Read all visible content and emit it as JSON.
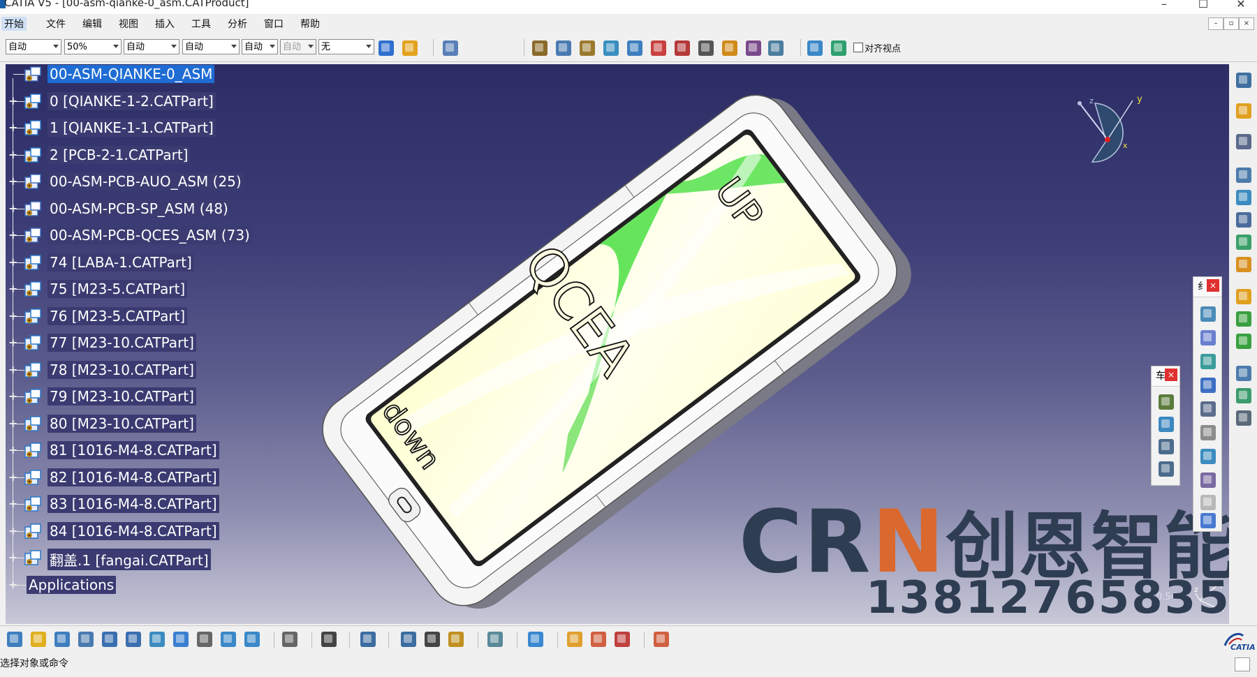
{
  "window": {
    "title": "CATIA V5 - [00-asm-qianke-0_asm.CATProduct]",
    "minimize": "–",
    "maximize": "☐",
    "close": "✕"
  },
  "menu": {
    "items": [
      "开始",
      "文件",
      "编辑",
      "视图",
      "插入",
      "工具",
      "分析",
      "窗口",
      "帮助"
    ],
    "mdi_controls": [
      "–",
      "▫",
      "×"
    ]
  },
  "toolbar": {
    "combos": [
      {
        "value": "自动",
        "disabled": false
      },
      {
        "value": "50%",
        "disabled": false
      },
      {
        "value": "自动",
        "disabled": false
      },
      {
        "value": "自动",
        "disabled": false
      },
      {
        "value": "自动",
        "disabled": false
      },
      {
        "value": "自动",
        "disabled": true
      },
      {
        "value": "无",
        "disabled": false
      }
    ],
    "align_viewpoint_label": "对齐视点"
  },
  "tree": {
    "nodes": [
      {
        "label": "00-ASM-QIANKE-0_ASM",
        "type": "root-product",
        "selected": true
      },
      {
        "label": "0 [QIANKE-1-2.CATPart]",
        "type": "part"
      },
      {
        "label": "1 [QIANKE-1-1.CATPart]",
        "type": "part"
      },
      {
        "label": "2 [PCB-2-1.CATPart]",
        "type": "part"
      },
      {
        "label": "00-ASM-PCB-AUO_ASM (25)",
        "type": "product"
      },
      {
        "label": "00-ASM-PCB-SP_ASM (48)",
        "type": "product"
      },
      {
        "label": "00-ASM-PCB-QCES_ASM (73)",
        "type": "product"
      },
      {
        "label": "74 [LABA-1.CATPart]",
        "type": "part"
      },
      {
        "label": "75 [M23-5.CATPart]",
        "type": "part"
      },
      {
        "label": "76 [M23-5.CATPart]",
        "type": "part"
      },
      {
        "label": "77 [M23-10.CATPart]",
        "type": "part"
      },
      {
        "label": "78 [M23-10.CATPart]",
        "type": "part"
      },
      {
        "label": "79 [M23-10.CATPart]",
        "type": "part"
      },
      {
        "label": "80 [M23-10.CATPart]",
        "type": "part"
      },
      {
        "label": "81 [1016-M4-8.CATPart]",
        "type": "part"
      },
      {
        "label": "82 [1016-M4-8.CATPart]",
        "type": "part"
      },
      {
        "label": "83 [1016-M4-8.CATPart]",
        "type": "part"
      },
      {
        "label": "84 [1016-M4-8.CATPart]",
        "type": "part"
      },
      {
        "label": "翻盖.1 [fangai.CATPart]",
        "type": "part"
      },
      {
        "label": "Applications",
        "type": "applications"
      }
    ]
  },
  "model": {
    "text_up": "UP",
    "text_middle": "QCEA",
    "text_down": "down"
  },
  "compass": {
    "x": "x",
    "y": "y",
    "z": "z"
  },
  "mini_axes": {
    "x": "x",
    "y": "y",
    "z": "z"
  },
  "scale_value": "0.544",
  "watermark": {
    "brand_pre": "CR",
    "brand_n": "N",
    "brand_cn": "创恩智能",
    "phone": "13812765835"
  },
  "floaters": {
    "glyph_a": "纟",
    "glyph_b": "车",
    "close": "×"
  },
  "status": {
    "prompt": "选择对象或命令"
  },
  "logo": {
    "text": "CATIA"
  },
  "colors": {
    "viewport_top": "#2d2d66",
    "selection": "#1f6cd4",
    "brand_n": "#d9692e",
    "brand": "#2f3d52"
  }
}
